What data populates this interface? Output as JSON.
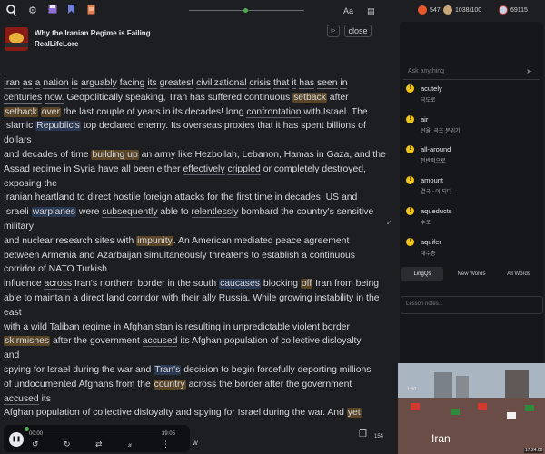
{
  "topbar": {
    "font_label": "Aa",
    "streak": "547",
    "coins": "1038/100",
    "known_words": "69115"
  },
  "lesson": {
    "title": "Why the Iranian Regime is Failing",
    "source": "RealLifeLore",
    "close_label": "close"
  },
  "text_lines": [
    [
      {
        "t": "Iran",
        "c": "ul"
      },
      {
        "t": " "
      },
      {
        "t": "as",
        "c": "ul"
      },
      {
        "t": " "
      },
      {
        "t": "a",
        "c": "ul"
      },
      {
        "t": " "
      },
      {
        "t": "nation",
        "c": "ul"
      },
      {
        "t": " "
      },
      {
        "t": "is",
        "c": "ul"
      },
      {
        "t": " "
      },
      {
        "t": "arguably",
        "c": "ul"
      },
      {
        "t": " "
      },
      {
        "t": "facing",
        "c": "ul"
      },
      {
        "t": " "
      },
      {
        "t": "its",
        "c": "ul"
      },
      {
        "t": " "
      },
      {
        "t": "greatest",
        "c": "ul"
      },
      {
        "t": " "
      },
      {
        "t": "civilizational",
        "c": "ul"
      },
      {
        "t": " "
      },
      {
        "t": "crisis",
        "c": "ul"
      },
      {
        "t": " "
      },
      {
        "t": "that",
        "c": "ul"
      },
      {
        "t": " "
      },
      {
        "t": "it",
        "c": "ul"
      },
      {
        "t": " "
      },
      {
        "t": "has",
        "c": "ul"
      },
      {
        "t": " "
      },
      {
        "t": "seen",
        "c": "ul"
      },
      {
        "t": " "
      },
      {
        "t": "in",
        "c": "ul"
      }
    ],
    [
      {
        "t": "centuries",
        "c": "ul"
      },
      {
        "t": " "
      },
      {
        "t": "now.",
        "c": "ul"
      },
      {
        "t": " Geopolitically speaking, Tran has suffered continuous "
      },
      {
        "t": "setback",
        "c": "hl"
      },
      {
        "t": " after"
      }
    ],
    [
      {
        "t": "setback",
        "c": "hl"
      },
      {
        "t": " "
      },
      {
        "t": "over",
        "c": "hl"
      },
      {
        "t": " the last couple of years in its decades! long "
      },
      {
        "t": "confrontation",
        "c": "w"
      },
      {
        "t": " with Israel. The"
      }
    ],
    [
      {
        "t": "Islamic "
      },
      {
        "t": "Republic's",
        "c": "bl"
      },
      {
        "t": " top declared enemy. Its overseas proxies that it has spent billions of"
      }
    ],
    [
      {
        "t": "dollars"
      }
    ],
    [
      {
        "t": "and decades of time "
      },
      {
        "t": "building up",
        "c": "hl"
      },
      {
        "t": " an army like Hezbollah, Lebanon, Hamas in Gaza, and the"
      }
    ],
    [
      {
        "t": "Assad regime in Syria have all been either "
      },
      {
        "t": "effectively",
        "c": "w"
      },
      {
        "t": " "
      },
      {
        "t": "crippled",
        "c": "w"
      },
      {
        "t": " or completely destroyed,"
      }
    ],
    [
      {
        "t": "exposing the"
      }
    ],
    [
      {
        "t": "Iranian heartland to direct hostile foreign attacks for the first time in decades. US and"
      }
    ],
    [
      {
        "t": "Israeli "
      },
      {
        "t": "warplanes",
        "c": "bl"
      },
      {
        "t": " were "
      },
      {
        "t": "subsequently",
        "c": "w"
      },
      {
        "t": " able to "
      },
      {
        "t": "relentlessly",
        "c": "w"
      },
      {
        "t": " bombard the country's sensitive"
      }
    ],
    [
      {
        "t": "military"
      }
    ],
    [
      {
        "t": "and nuclear research sites with "
      },
      {
        "t": "impunity",
        "c": "hl"
      },
      {
        "t": ". An American mediated peace agreement"
      }
    ],
    [
      {
        "t": "between Armenia and Azarbaijan simultaneously threatens to establish a continuous"
      }
    ],
    [
      {
        "t": "corridor of NATO Turkish"
      }
    ],
    [
      {
        "t": "influence "
      },
      {
        "t": "across",
        "c": "w"
      },
      {
        "t": " Iran's northern border in the south "
      },
      {
        "t": "caucases",
        "c": "bl"
      },
      {
        "t": " blocking "
      },
      {
        "t": "off",
        "c": "hl"
      },
      {
        "t": " Iran from being"
      }
    ],
    [
      {
        "t": "able to maintain a direct land corridor with their ally Russia. While growing instability in the"
      }
    ],
    [
      {
        "t": "east"
      }
    ],
    [
      {
        "t": "with a wild Taliban regime in Afghanistan is resulting in unpredictable violent border"
      }
    ],
    [
      {
        "t": "skirmishes",
        "c": "hl"
      },
      {
        "t": " after the government "
      },
      {
        "t": "accused",
        "c": "w"
      },
      {
        "t": " its Afghan population of collective disloyalty"
      }
    ],
    [
      {
        "t": "and"
      }
    ],
    [
      {
        "t": "spying for Israel during the war and "
      },
      {
        "t": "Tran's",
        "c": "bl"
      },
      {
        "t": " decision to begin forcefully deporting millions"
      }
    ],
    [
      {
        "t": "of undocumented Afghans from the "
      },
      {
        "t": "country",
        "c": "hl"
      },
      {
        "t": " "
      },
      {
        "t": "across",
        "c": "w"
      },
      {
        "t": " the border after the government"
      }
    ],
    [
      {
        "t": "accused",
        "c": "w"
      },
      {
        "t": " its"
      }
    ],
    [
      {
        "t": "Afghan population of collective disloyalty and spying for Israel during the war. And "
      },
      {
        "t": "yet",
        "c": "hl"
      }
    ]
  ],
  "player": {
    "current_time": "00:00",
    "duration": "39:05",
    "progress": 0.0,
    "speed_label": "w"
  },
  "pager": {
    "page": "154"
  },
  "sidebar": {
    "ask_placeholder": "Ask anything",
    "lingqs": [
      {
        "word": "acutely",
        "translation": "극도로"
      },
      {
        "word": "air",
        "translation": "선율, 곡조 분위기"
      },
      {
        "word": "all-around",
        "translation": "전반적으로"
      },
      {
        "word": "amount",
        "translation": "결국 ~이 되다"
      },
      {
        "word": "aqueducts",
        "translation": "수로"
      },
      {
        "word": "aquifer",
        "translation": "대수층"
      }
    ],
    "tabs": [
      "LingQs",
      "New Words",
      "All Words"
    ],
    "notes_placeholder": "Lesson notes..."
  },
  "video": {
    "caption": "Iran",
    "timestamp": "17:24:08",
    "badge": "1:50"
  },
  "colors": {
    "accent": "#4caf50",
    "lingq_yellow": "#f0c419",
    "highlight": "#5a4527",
    "blue_highlight": "#2a3750"
  }
}
